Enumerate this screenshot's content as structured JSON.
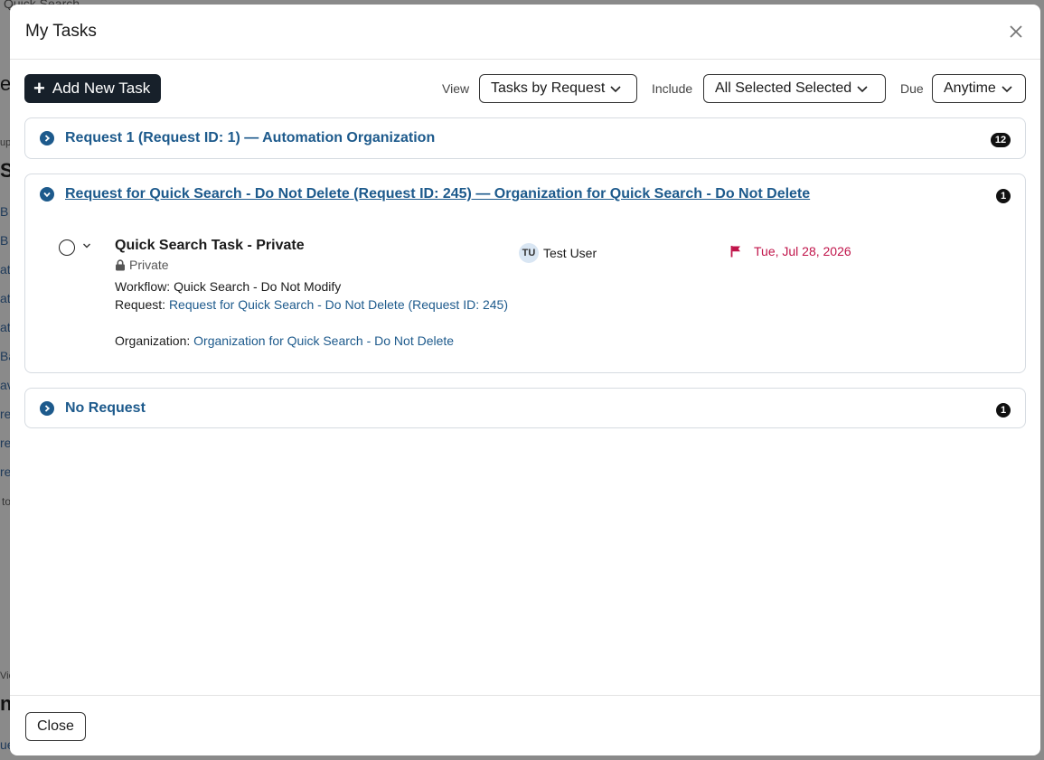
{
  "background": {
    "fragments": [
      "Quick Search",
      "e",
      "up",
      "S",
      "B",
      "B",
      "at",
      "at",
      "at",
      "Ba",
      "av",
      "re",
      "re",
      "re",
      "to",
      "Vie",
      "ni",
      "ue"
    ]
  },
  "modal": {
    "title": "My Tasks",
    "close_icon": "close-icon"
  },
  "toolbar": {
    "add_label": "Add New Task",
    "view_label": "View",
    "view_value": "Tasks by Request",
    "include_label": "Include",
    "include_value": "All Selected Selected",
    "due_label": "Due",
    "due_value": "Anytime"
  },
  "groups": [
    {
      "title": "Request 1 (Request ID: 1) — Automation Organization",
      "count": "12",
      "expanded": false
    },
    {
      "title": "Request for Quick Search - Do Not Delete (Request ID: 245) — Organization for Quick Search - Do Not Delete",
      "count": "1",
      "expanded": true,
      "task": {
        "name": "Quick Search Task - Private",
        "privacy": "Private",
        "workflow_label": "Workflow:",
        "workflow_value": "Quick Search - Do Not Modify",
        "request_label": "Request:",
        "request_value": "Request for Quick Search - Do Not Delete (Request ID: 245)",
        "organization_label": "Organization:",
        "organization_value": "Organization for Quick Search - Do Not Delete",
        "assignee_initials": "TU",
        "assignee_name": "Test User",
        "due_date": "Tue, Jul 28, 2026"
      }
    },
    {
      "title": "No Request",
      "count": "1",
      "expanded": false
    }
  ],
  "footer": {
    "close_label": "Close"
  },
  "colors": {
    "link": "#1d5a8c",
    "due": "#c0144a",
    "primary_button": "#17202a"
  }
}
